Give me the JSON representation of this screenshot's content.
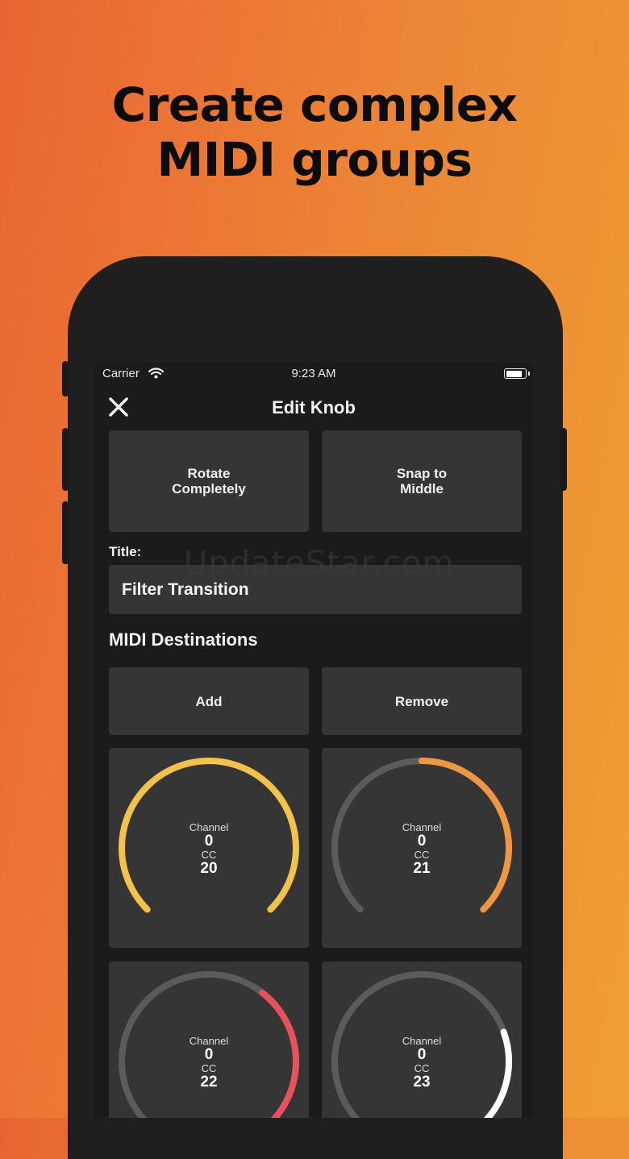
{
  "headline": {
    "line1": "Create complex",
    "line2": "MIDI groups"
  },
  "status_bar": {
    "carrier": "Carrier",
    "time": "9:23 AM"
  },
  "nav": {
    "title": "Edit Knob"
  },
  "mode_buttons": {
    "rotate": "Rotate\nCompletely",
    "snap": "Snap to\nMiddle"
  },
  "title_field": {
    "label": "Title:",
    "value": "Filter Transition"
  },
  "destinations": {
    "heading": "MIDI Destinations",
    "add_label": "Add",
    "remove_label": "Remove",
    "knobs": [
      {
        "channel_label": "Channel",
        "channel": "0",
        "cc_label": "CC",
        "cc": "20",
        "color": "#f2c24a",
        "fill": 1.0
      },
      {
        "channel_label": "Channel",
        "channel": "0",
        "cc_label": "CC",
        "cc": "21",
        "color": "#ee9641",
        "fill": 0.5
      },
      {
        "channel_label": "Channel",
        "channel": "0",
        "cc_label": "CC",
        "cc": "22",
        "color": "#e8505b",
        "fill": 0.36
      },
      {
        "channel_label": "Channel",
        "channel": "0",
        "cc_label": "CC",
        "cc": "23",
        "color": "#ffffff",
        "fill": 0.24
      }
    ]
  },
  "watermark": "UpdateStar.com",
  "colors": {
    "track": "#5b5b5b",
    "tile": "#353535",
    "screen": "#1b1b1b"
  }
}
